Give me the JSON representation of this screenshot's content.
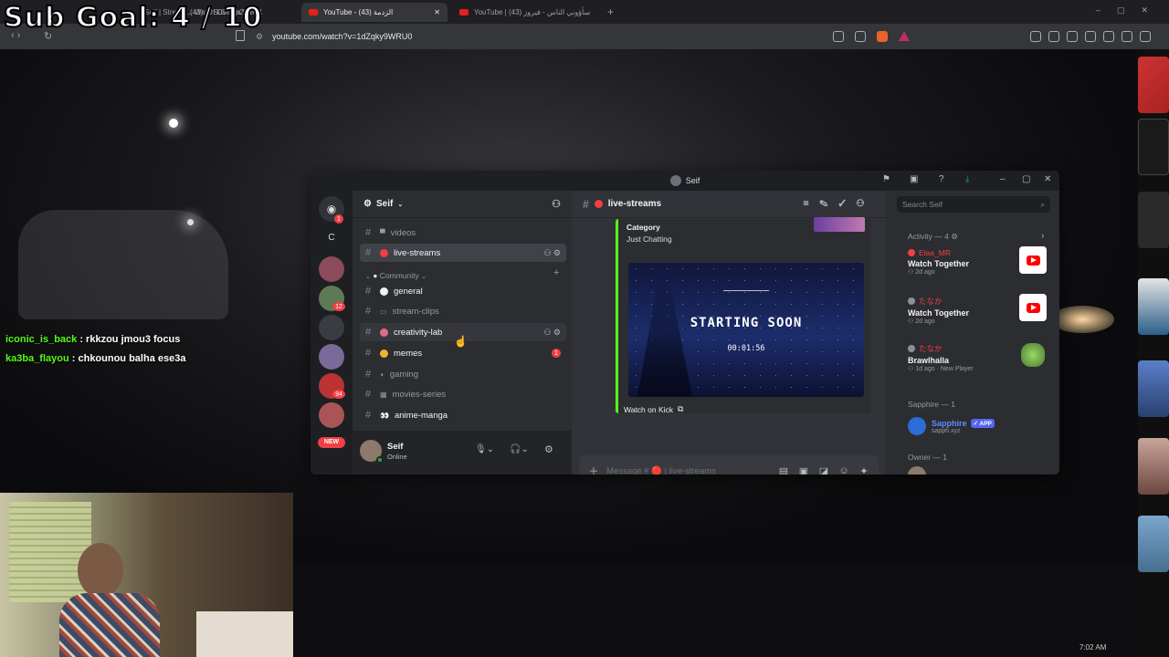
{
  "overlay": {
    "sub_goal": "Sub Goal: 4 / 10",
    "chat": [
      {
        "user": "iconic_is_back",
        "message": " : rkkzou jmou3 focus"
      },
      {
        "user": "ka3ba_flayou",
        "message": " : chkounou balha ese3a"
      }
    ]
  },
  "browser": {
    "tabs": [
      {
        "label": "Seif | Stream... Watch Live on Kick"
      },
      {
        "label": "(43) ... S03- Ep27 P01"
      },
      {
        "label": "YouTube - الزدمة (43)"
      },
      {
        "label": "YouTube | سأؤوني الناس - فيروز (43)"
      }
    ],
    "url": "youtube.com/watch?v=1dZqky9WRU0",
    "clock": "7:02 AM"
  },
  "discord": {
    "window_title": "Seif",
    "server_name": "Seif",
    "server_letter": "C",
    "server_badges": {
      "a": "1",
      "b": "12",
      "c": "94",
      "new": "NEW"
    },
    "channels_top": [
      {
        "name": "videos"
      },
      {
        "name": "live-streams"
      }
    ],
    "category": "Community",
    "channels": [
      {
        "name": "general"
      },
      {
        "name": "stream-clips"
      },
      {
        "name": "creativity-lab"
      },
      {
        "name": "memes",
        "badge": "1"
      },
      {
        "name": "gaming"
      },
      {
        "name": "movies-series"
      },
      {
        "name": "anime-manga"
      }
    ],
    "user": {
      "name": "Seif",
      "status": "Online"
    },
    "main": {
      "channel": "live-streams",
      "embed": {
        "category_label": "Category",
        "category_value": "Just Chatting",
        "preview_title": "STARTING SOON",
        "preview_timer": "00:01:56",
        "watch_button": "Watch on Kick"
      },
      "message_placeholder": "Message # 🔴 | live-streams"
    },
    "sidebar": {
      "search_placeholder": "Search Seif",
      "activity_header": "Activity — 4",
      "activities": [
        {
          "user": "Elaa_MR",
          "title": "Watch Together",
          "sub": "2d ago"
        },
        {
          "user": "たなか",
          "title": "Watch Together",
          "sub": "2d ago"
        },
        {
          "user": "たなか",
          "title": "Brawlhalla",
          "sub": "1d ago · New Player"
        }
      ],
      "sapphire_header": "Sapphire — 1",
      "sapphire_name": "Sapphire",
      "sapphire_tag": "APP",
      "sapphire_sub": "sapph.xyz",
      "owner_header": "Owner — 1"
    }
  }
}
